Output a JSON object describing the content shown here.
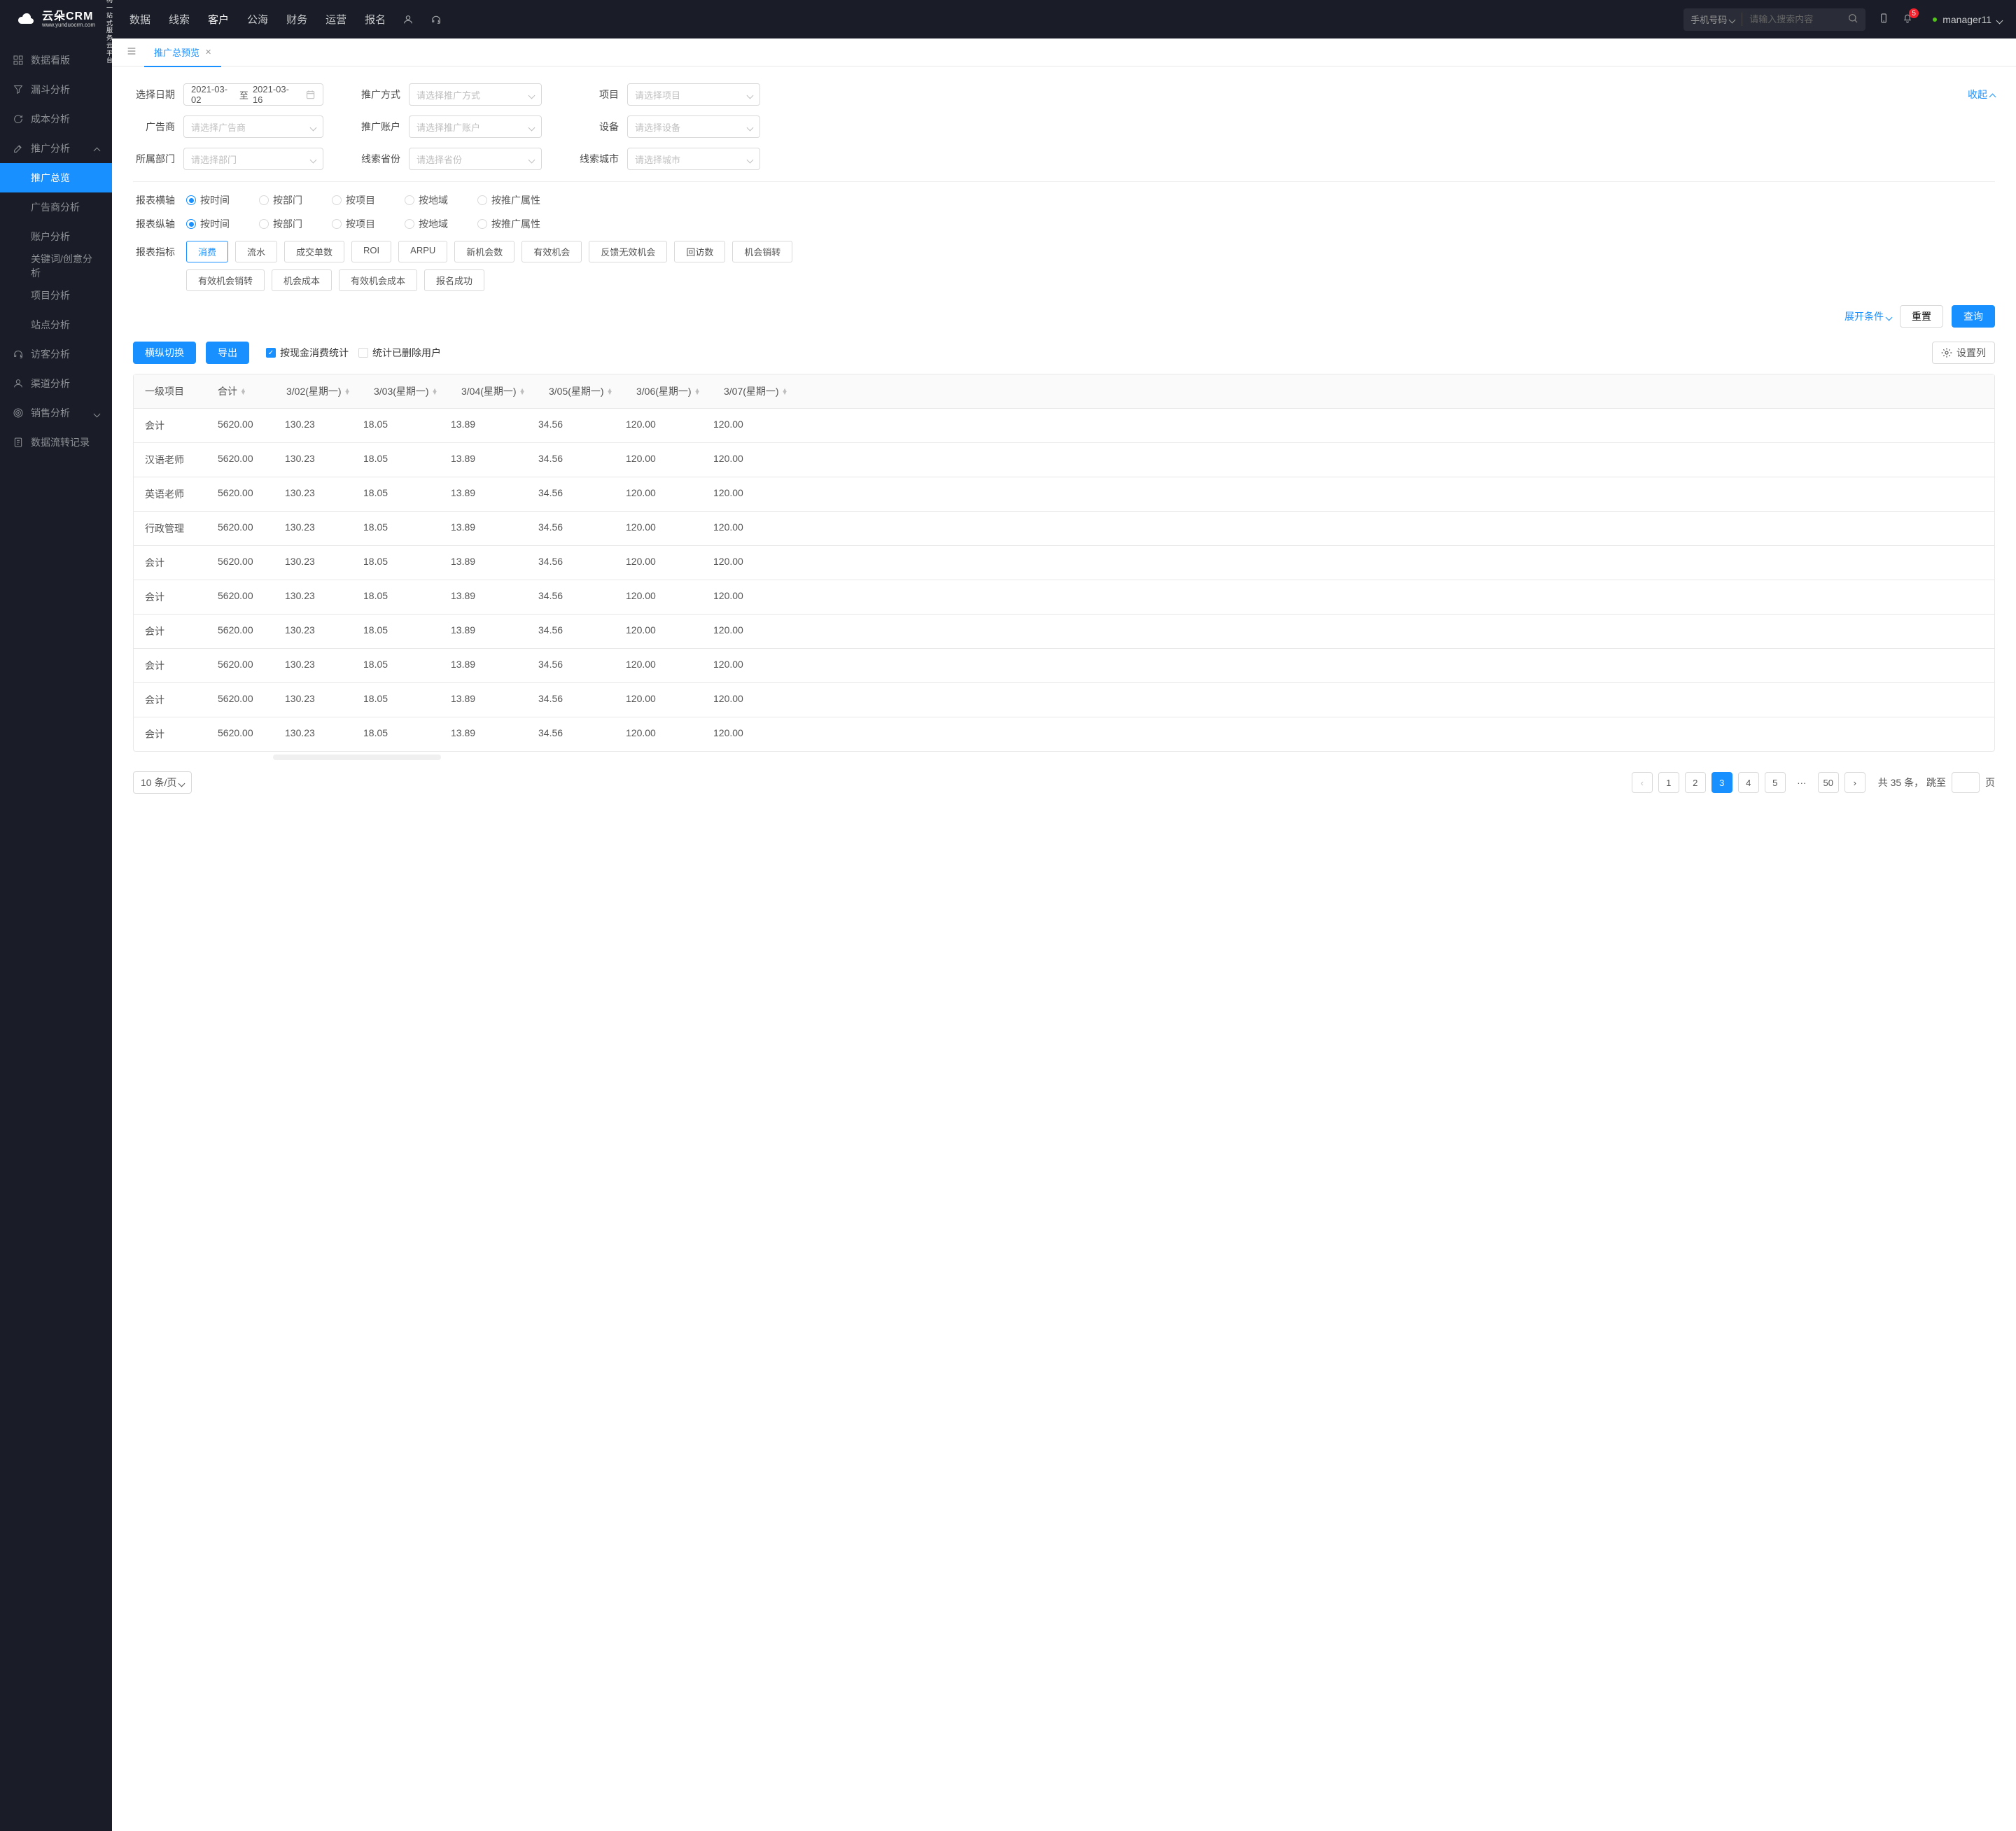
{
  "brand": {
    "name": "云朵CRM",
    "sub": "www.yunduocrm.com",
    "side1": "教育机构一站",
    "side2": "式服务云平台"
  },
  "topnav": [
    "数据",
    "线索",
    "客户",
    "公海",
    "财务",
    "运营",
    "报名"
  ],
  "topnav_active": 2,
  "search": {
    "type": "手机号码",
    "placeholder": "请输入搜索内容"
  },
  "badge": "5",
  "user": "manager11",
  "sidebar": {
    "items": [
      {
        "label": "数据看版",
        "icon": "dashboard"
      },
      {
        "label": "漏斗分析",
        "icon": "funnel"
      },
      {
        "label": "成本分析",
        "icon": "refresh"
      },
      {
        "label": "推广分析",
        "icon": "edit",
        "expanded": true,
        "children": [
          {
            "label": "推广总览",
            "active": true
          },
          {
            "label": "广告商分析"
          },
          {
            "label": "账户分析"
          },
          {
            "label": "关键词/创意分析"
          },
          {
            "label": "项目分析"
          },
          {
            "label": "站点分析"
          }
        ]
      },
      {
        "label": "访客分析",
        "icon": "headset"
      },
      {
        "label": "渠道分析",
        "icon": "user"
      },
      {
        "label": "销售分析",
        "icon": "target",
        "arrow": true
      },
      {
        "label": "数据流转记录",
        "icon": "doc"
      }
    ]
  },
  "tab": {
    "title": "推广总预览"
  },
  "filters": {
    "date_label": "选择日期",
    "date_from": "2021-03-02",
    "date_sep": "至",
    "date_to": "2021-03-16",
    "method_label": "推广方式",
    "method_ph": "请选择推广方式",
    "project_label": "项目",
    "project_ph": "请选择项目",
    "advertiser_label": "广告商",
    "advertiser_ph": "请选择广告商",
    "account_label": "推广账户",
    "account_ph": "请选择推广账户",
    "device_label": "设备",
    "device_ph": "请选择设备",
    "dept_label": "所属部门",
    "dept_ph": "请选择部门",
    "province_label": "线索省份",
    "province_ph": "请选择省份",
    "city_label": "线索城市",
    "city_ph": "请选择城市",
    "collapse": "收起"
  },
  "axes": {
    "x_label": "报表横轴",
    "y_label": "报表纵轴",
    "opts": [
      "按时间",
      "按部门",
      "按项目",
      "按地域",
      "按推广属性"
    ],
    "x_checked": 0,
    "y_checked": 0
  },
  "metrics": {
    "label": "报表指标",
    "list": [
      "消费",
      "流水",
      "成交单数",
      "ROI",
      "ARPU",
      "新机会数",
      "有效机会",
      "反馈无效机会",
      "回访数",
      "机会销转",
      "有效机会销转",
      "机会成本",
      "有效机会成本",
      "报名成功"
    ],
    "active": 0
  },
  "actions": {
    "expand": "展开条件",
    "reset": "重置",
    "query": "查询"
  },
  "tabletop": {
    "switch": "横纵切换",
    "export": "导出",
    "chk1": "按现金消费统计",
    "chk2": "统计已删除用户",
    "setcol": "设置列"
  },
  "table": {
    "headers": [
      "一级项目",
      "合计",
      "3/02(星期一)",
      "3/03(星期一)",
      "3/04(星期一)",
      "3/05(星期一)",
      "3/06(星期一)",
      "3/07(星期一)"
    ],
    "rows": [
      {
        "name": "会计",
        "total": "5620.00",
        "d302": "130.23",
        "d303": "18.05",
        "d304": "13.89",
        "d305": "34.56",
        "d306": "120.00",
        "d307": "120.00"
      },
      {
        "name": "汉语老师",
        "total": "5620.00",
        "d302": "130.23",
        "d303": "18.05",
        "d304": "13.89",
        "d305": "34.56",
        "d306": "120.00",
        "d307": "120.00"
      },
      {
        "name": "英语老师",
        "total": "5620.00",
        "d302": "130.23",
        "d303": "18.05",
        "d304": "13.89",
        "d305": "34.56",
        "d306": "120.00",
        "d307": "120.00"
      },
      {
        "name": "行政管理",
        "total": "5620.00",
        "d302": "130.23",
        "d303": "18.05",
        "d304": "13.89",
        "d305": "34.56",
        "d306": "120.00",
        "d307": "120.00"
      },
      {
        "name": "会计",
        "total": "5620.00",
        "d302": "130.23",
        "d303": "18.05",
        "d304": "13.89",
        "d305": "34.56",
        "d306": "120.00",
        "d307": "120.00"
      },
      {
        "name": "会计",
        "total": "5620.00",
        "d302": "130.23",
        "d303": "18.05",
        "d304": "13.89",
        "d305": "34.56",
        "d306": "120.00",
        "d307": "120.00"
      },
      {
        "name": "会计",
        "total": "5620.00",
        "d302": "130.23",
        "d303": "18.05",
        "d304": "13.89",
        "d305": "34.56",
        "d306": "120.00",
        "d307": "120.00"
      },
      {
        "name": "会计",
        "total": "5620.00",
        "d302": "130.23",
        "d303": "18.05",
        "d304": "13.89",
        "d305": "34.56",
        "d306": "120.00",
        "d307": "120.00"
      },
      {
        "name": "会计",
        "total": "5620.00",
        "d302": "130.23",
        "d303": "18.05",
        "d304": "13.89",
        "d305": "34.56",
        "d306": "120.00",
        "d307": "120.00"
      },
      {
        "name": "会计",
        "total": "5620.00",
        "d302": "130.23",
        "d303": "18.05",
        "d304": "13.89",
        "d305": "34.56",
        "d306": "120.00",
        "d307": "120.00"
      }
    ]
  },
  "pager": {
    "size_label": "10 条/页",
    "pages": [
      "1",
      "2",
      "3",
      "4",
      "5"
    ],
    "last": "50",
    "active": 2,
    "total_prefix": "共",
    "total_count": "35",
    "total_suffix": "条，",
    "jump": "跳至",
    "page_suffix": "页"
  }
}
